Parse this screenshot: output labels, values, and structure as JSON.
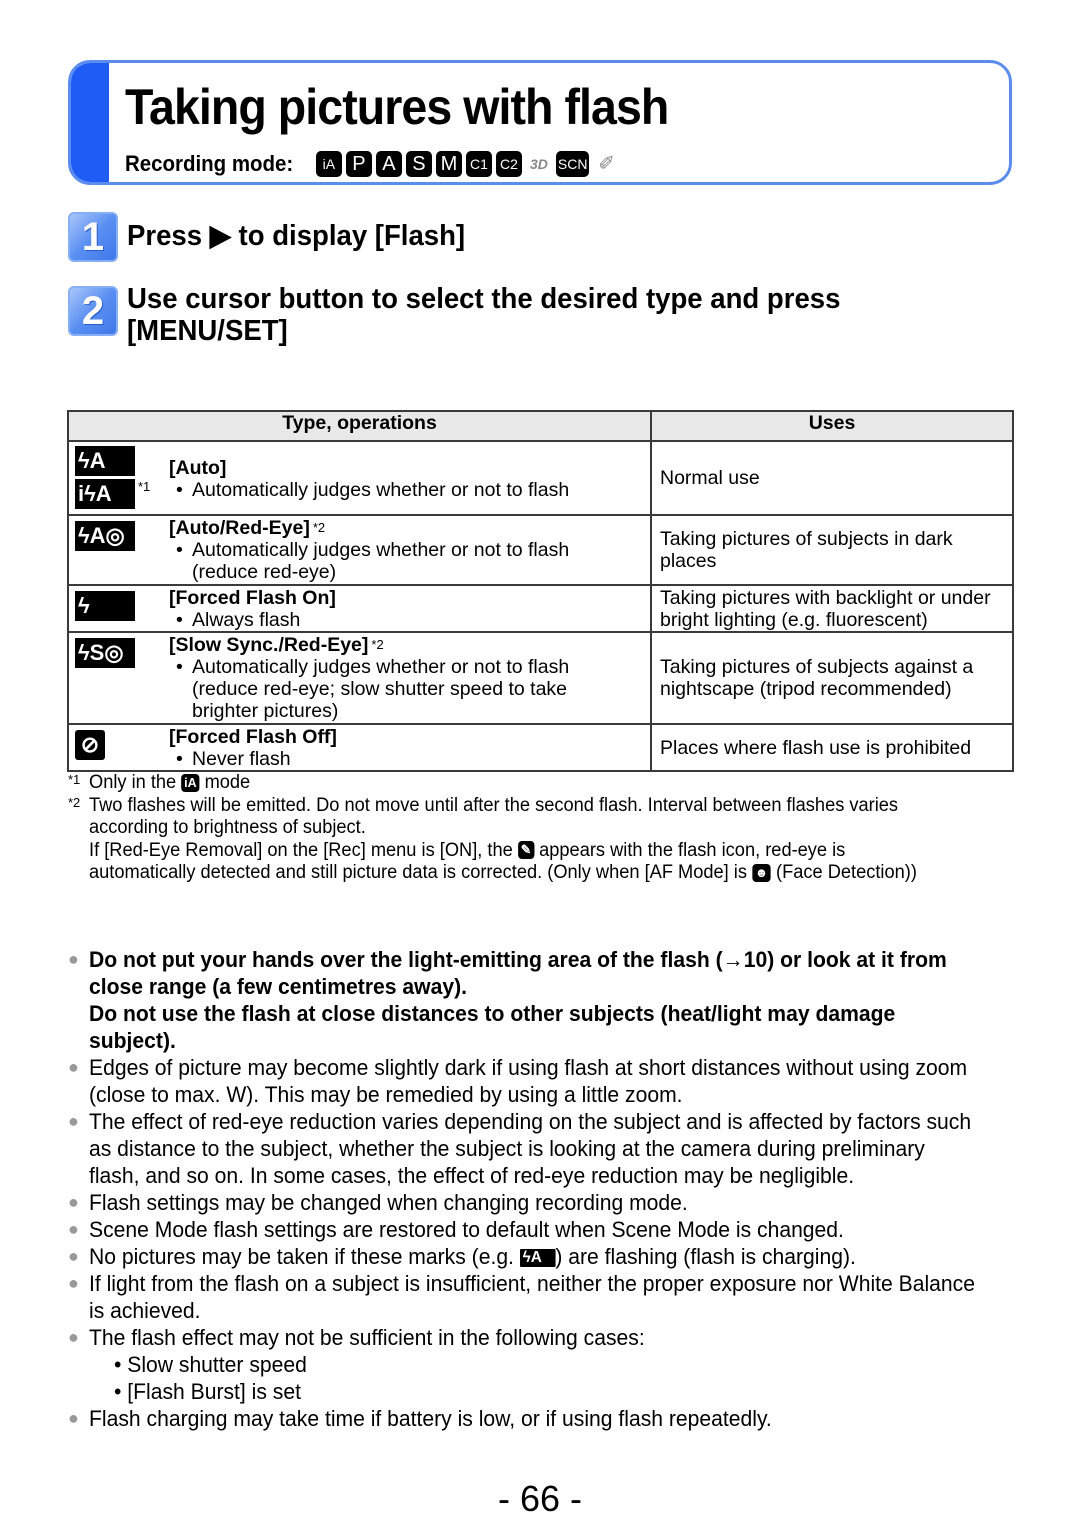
{
  "header": {
    "title": "Taking pictures with flash",
    "recording_mode_label": "Recording mode:",
    "modes": [
      {
        "name": "intelligent-auto",
        "glyph": "iA"
      },
      {
        "name": "program",
        "glyph": "P"
      },
      {
        "name": "aperture",
        "glyph": "A"
      },
      {
        "name": "shutter",
        "glyph": "S"
      },
      {
        "name": "manual",
        "glyph": "M"
      },
      {
        "name": "custom-1",
        "glyph": "C1"
      },
      {
        "name": "custom-2",
        "glyph": "C2"
      },
      {
        "name": "3d",
        "glyph": "3D"
      },
      {
        "name": "scene",
        "glyph": "SCN"
      },
      {
        "name": "creative",
        "glyph": "✐"
      }
    ],
    "accent_color": "#1f5cf5"
  },
  "steps": [
    {
      "number": "1",
      "text": "Press ▶ to display [Flash]"
    },
    {
      "number": "2",
      "text": "Use cursor button to select the desired type and press [MENU/SET]"
    }
  ],
  "table": {
    "headers": [
      "Type, operations",
      "Uses"
    ],
    "rows": [
      {
        "icons": [
          "ϟA",
          "iϟA"
        ],
        "icon_note": "*1",
        "title": "[Auto]",
        "title_note": "",
        "bullet": "Automatically judges whether or not to flash",
        "continuation": [],
        "uses": "Normal use"
      },
      {
        "icons": [
          "ϟA◎"
        ],
        "icon_note": "",
        "title": "[Auto/Red-Eye]",
        "title_note": "*2",
        "bullet": "Automatically judges whether or not to flash",
        "continuation": [
          "(reduce red-eye)"
        ],
        "uses": "Taking pictures of subjects in dark places"
      },
      {
        "icons": [
          "ϟ"
        ],
        "icon_note": "",
        "title": "[Forced Flash On]",
        "title_note": "",
        "bullet": "Always flash",
        "continuation": [],
        "uses": "Taking pictures with backlight or under bright lighting (e.g. fluorescent)"
      },
      {
        "icons": [
          "ϟS◎"
        ],
        "icon_note": "",
        "title": "[Slow Sync./Red-Eye]",
        "title_note": "*2",
        "bullet": "Automatically judges whether or not to flash",
        "continuation": [
          "(reduce red-eye; slow shutter speed to take",
          "brighter pictures)"
        ],
        "uses": "Taking pictures of subjects against a nightscape (tripod recommended)"
      },
      {
        "icons": [
          "⊘"
        ],
        "icon_note": "",
        "title": "[Forced Flash Off]",
        "title_note": "",
        "bullet": "Never flash",
        "continuation": [],
        "uses": "Places where flash use is prohibited"
      }
    ]
  },
  "footnotes": {
    "fn1": {
      "mark": "*1",
      "before": "Only in the ",
      "icon": "iA",
      "after": " mode"
    },
    "fn2": {
      "mark": "*2",
      "line1": "Two flashes will be emitted. Do not move until after the second flash. Interval between flashes varies according to brightness of subject.",
      "line2_before": "If [Red-Eye Removal] on the [Rec] menu is [ON], the ",
      "line2_icon": "✎",
      "line2_middle": " appears with the flash icon, red-eye is automatically detected and still picture data is corrected. (Only when [AF Mode] is ",
      "line2_icon2": "☻",
      "line2_after": " (Face Detection))"
    }
  },
  "notes": [
    {
      "bold": true,
      "text": "Do not put your hands over the light-emitting area of the flash (→10) or look at it from close range (a few centimetres away)."
    },
    {
      "bold": true,
      "continuation": true,
      "text": "Do not use the flash at close distances to other subjects (heat/light may damage subject)."
    },
    {
      "bold": false,
      "text": "Edges of picture may become slightly dark if using flash at short distances without using zoom (close to max. W). This may be remedied by using a little zoom."
    },
    {
      "bold": false,
      "text": "The effect of red-eye reduction varies depending on the subject and is affected by factors such as distance to the subject, whether the subject is looking at the camera during preliminary flash, and so on. In some cases, the effect of red-eye reduction may be negligible."
    },
    {
      "bold": false,
      "text": "Flash settings may be changed when changing recording mode."
    },
    {
      "bold": false,
      "text": "Scene Mode flash settings are restored to default when Scene Mode is changed."
    },
    {
      "bold": false,
      "text_before": "No pictures may be taken if these marks (e.g. ",
      "icon": "ϟA",
      "text_after": ") are flashing (flash is charging)."
    },
    {
      "bold": false,
      "text": "If light from the flash on a subject is insufficient, neither the proper exposure nor White Balance is achieved."
    },
    {
      "bold": false,
      "text": "The flash effect may not be sufficient in the following cases:",
      "sub": [
        "Slow shutter speed",
        "[Flash Burst] is set"
      ]
    },
    {
      "bold": false,
      "text": "Flash charging may take time if battery is low, or if using flash repeatedly."
    }
  ],
  "page_number": "- 66 -"
}
